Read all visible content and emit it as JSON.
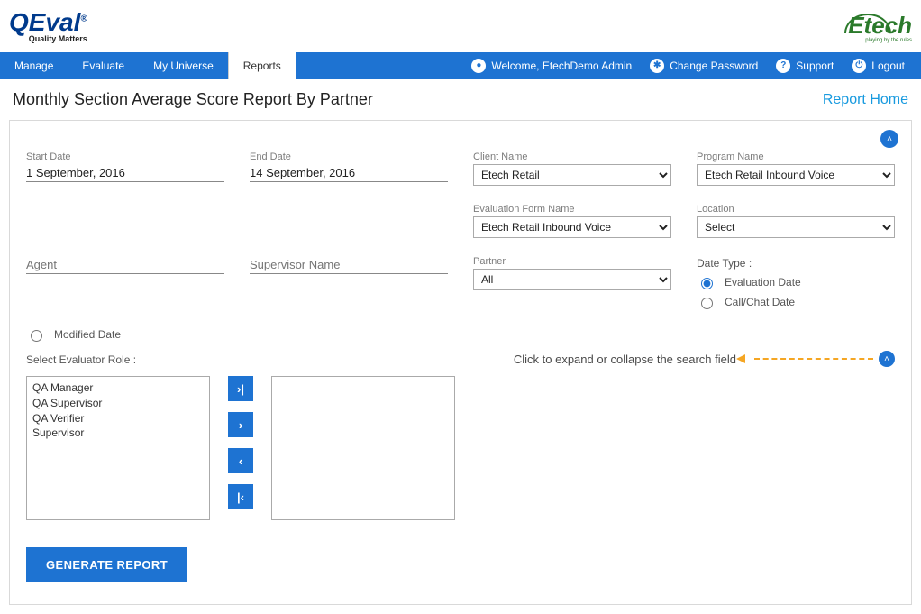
{
  "logos": {
    "qeval_main": "QEval",
    "qeval_sub": "Quality Matters",
    "etech": "Etech",
    "etech_tag": "playing by the rules"
  },
  "nav": {
    "items": [
      "Manage",
      "Evaluate",
      "My Universe",
      "Reports"
    ],
    "active_index": 3,
    "welcome": "Welcome, EtechDemo Admin",
    "change_password": "Change Password",
    "support": "Support",
    "logout": "Logout"
  },
  "title": "Monthly Section Average Score Report By Partner",
  "report_home": "Report Home",
  "form": {
    "start_date": {
      "label": "Start Date",
      "value": "1 September, 2016"
    },
    "end_date": {
      "label": "End Date",
      "value": "14 September, 2016"
    },
    "client_name": {
      "label": "Client Name",
      "value": "Etech Retail"
    },
    "program_name": {
      "label": "Program Name",
      "value": "Etech Retail Inbound Voice"
    },
    "eval_form": {
      "label": "Evaluation Form Name",
      "value": "Etech Retail Inbound Voice"
    },
    "location": {
      "label": "Location",
      "value": "Select"
    },
    "agent": {
      "label": "Agent",
      "value": ""
    },
    "supervisor": {
      "label": "Supervisor Name",
      "value": ""
    },
    "partner": {
      "label": "Partner",
      "value": "All"
    },
    "date_type_label": "Date Type :",
    "date_type_options": {
      "evaluation": "Evaluation Date",
      "callchat": "Call/Chat Date"
    },
    "modified_date": "Modified Date",
    "role_label": "Select Evaluator Role :",
    "role_options": [
      "QA Manager",
      "QA Supervisor",
      "QA Verifier",
      "Supervisor"
    ],
    "generate": "GENERATE REPORT"
  },
  "annotation": "Click to expand or collapse the search field"
}
